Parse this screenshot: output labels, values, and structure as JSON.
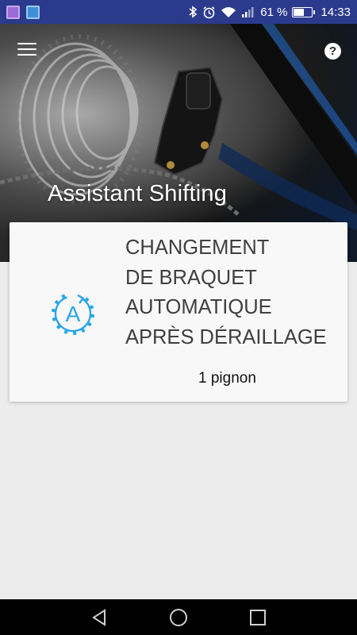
{
  "status_bar": {
    "battery_percent": "61 %",
    "battery_level": 0.61,
    "time": "14:33",
    "icons": [
      "gallery-notification-icon",
      "play-notification-icon",
      "bluetooth-icon",
      "alarm-icon",
      "wifi-icon",
      "signal-icon",
      "battery-icon"
    ]
  },
  "header": {
    "title": "Assistant Shifting",
    "menu_icon": "hamburger-menu-icon",
    "help_icon": "help-icon",
    "help_glyph": "?"
  },
  "card": {
    "icon": "auto-shift-gear-icon",
    "icon_letter": "A",
    "accent_color": "#2aa6e8",
    "title_lines": [
      "CHANGEMENT",
      "DE BRAQUET",
      "AUTOMATIQUE",
      "APRÈS DÉRAILLAGE"
    ],
    "value": "1 pignon"
  },
  "nav_bar": {
    "buttons": [
      "back-icon",
      "home-icon",
      "recents-icon"
    ]
  }
}
